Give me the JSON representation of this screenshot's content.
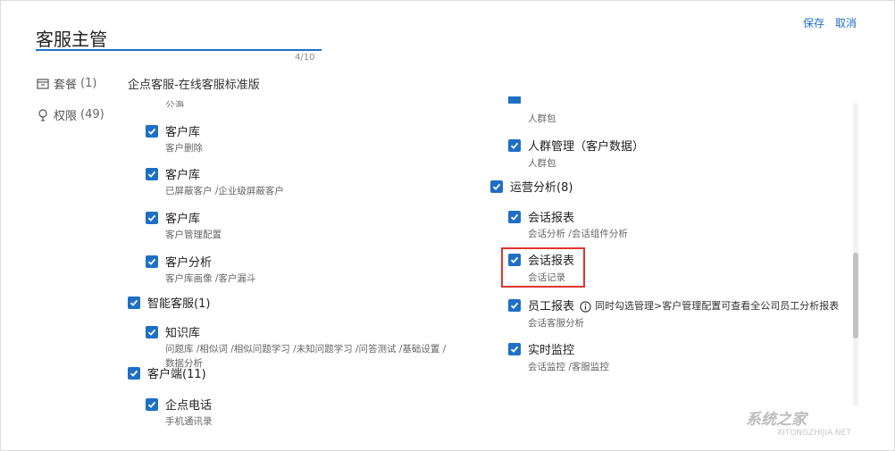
{
  "header": {
    "role_title": "客服主管",
    "char_count": "4/10",
    "save_label": "保存",
    "cancel_label": "取消"
  },
  "sidebar": {
    "items": [
      {
        "label": "套餐",
        "count": "(1)"
      },
      {
        "label": "权限",
        "count": "(49)"
      }
    ]
  },
  "package_name": "企点客服-在线客服标准版",
  "permissions": {
    "left": {
      "truncated_top": "公海",
      "customer_library_1": {
        "label": "客户库",
        "sub": "客户删除"
      },
      "customer_library_2": {
        "label": "客户库",
        "sub": "已屏蔽客户 /企业级屏蔽客户"
      },
      "customer_library_3": {
        "label": "客户库",
        "sub": "客户管理配置"
      },
      "customer_analysis": {
        "label": "客户分析",
        "sub": "客户库画像 /客户漏斗"
      },
      "smart_service": {
        "label": "智能客服(1)"
      },
      "knowledge_base": {
        "label": "知识库",
        "sub_line1": "问题库 /相似词 /相似问题学习 /未知问题学习 /问答测试 /基础设置 /",
        "sub_line2": "数据分析"
      },
      "client": {
        "label": "客户端(11)"
      },
      "qidian_phone": {
        "label": "企点电话",
        "sub": "手机通讯录"
      }
    },
    "right": {
      "truncated_top": "人群包",
      "crowd_management": {
        "label": "人群管理（客户数据）",
        "sub": "人群包"
      },
      "ops_analysis": {
        "label": "运营分析(8)"
      },
      "session_report_1": {
        "label": "会话报表",
        "sub": "会话分析 /会话组件分析"
      },
      "session_report_2": {
        "label": "会话报表",
        "sub": "会话记录"
      },
      "staff_report": {
        "label": "员工报表",
        "note": "同时勾选管理>客户管理配置可查看全公司员工分析报表",
        "sub": "会话客服分析"
      },
      "realtime_monitor": {
        "label": "实时监控",
        "sub": "会话监控 /客服监控"
      }
    }
  },
  "watermark": {
    "text": "系统之家",
    "sub": "XITONGZHIJIA.NET"
  },
  "colors": {
    "accent": "#1f6fc5",
    "highlight": "#e0342c"
  }
}
